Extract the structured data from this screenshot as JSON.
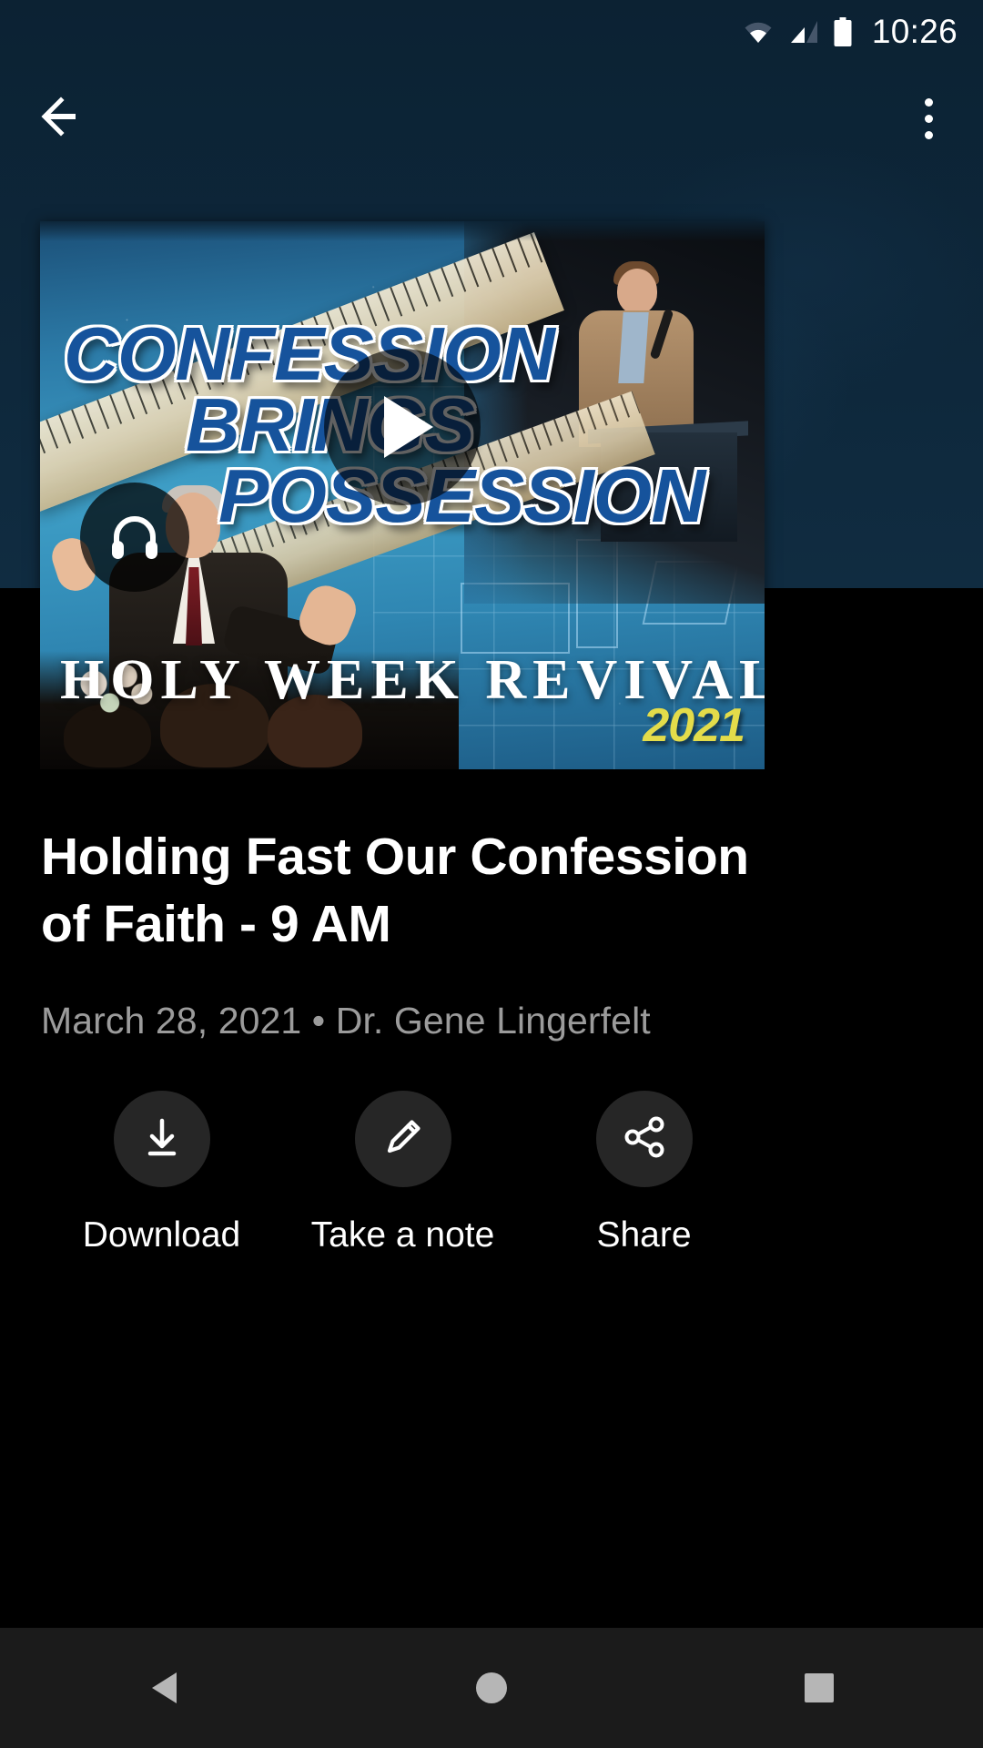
{
  "status_bar": {
    "time": "10:26",
    "icons": [
      "wifi-icon",
      "cell-signal-icon",
      "battery-icon"
    ]
  },
  "app_bar": {
    "back_icon": "back-arrow-icon",
    "overflow_icon": "overflow-menu-icon"
  },
  "player": {
    "play_icon": "play-icon",
    "audio_icon": "headphones-icon",
    "thumbnail": {
      "headline_line1": "CONFESSION",
      "headline_line2": "BRINGS",
      "headline_line3": "POSSESSION",
      "banner": "HOLY WEEK REVIVAL",
      "year": "2021",
      "headline_color": "#16539c",
      "year_color": "#e3dc4a"
    }
  },
  "video": {
    "title": "Holding Fast Our Confession of Faith - 9 AM",
    "meta": "March 28, 2021 • Dr. Gene Lingerfelt",
    "date": "March 28, 2021",
    "speaker": "Dr. Gene Lingerfelt"
  },
  "actions": [
    {
      "label": "Download",
      "icon": "download-icon"
    },
    {
      "label": "Take a note",
      "icon": "pencil-icon"
    },
    {
      "label": "Share",
      "icon": "share-icon"
    }
  ],
  "nav_bar": {
    "back_icon": "nav-back-icon",
    "home_icon": "nav-home-icon",
    "recents_icon": "nav-recents-icon"
  },
  "theme": {
    "header_bg": "#0d2639",
    "page_bg": "#000000",
    "accent_circle": "#262626",
    "meta_text": "#9b9b9b",
    "nav_bg": "#1b1b1b"
  }
}
